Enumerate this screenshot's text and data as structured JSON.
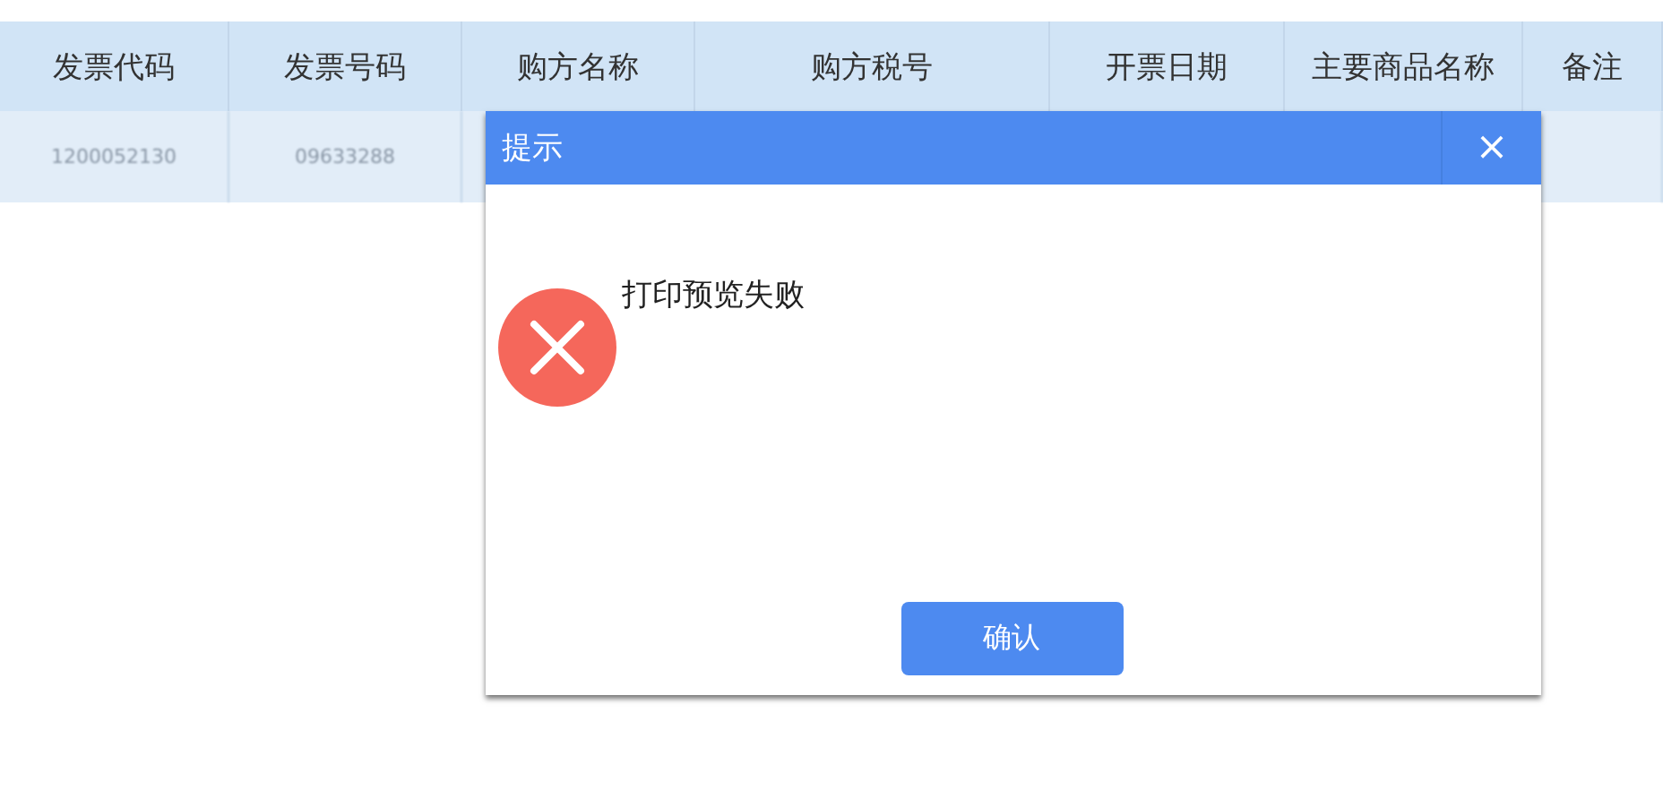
{
  "table": {
    "columns": [
      "发票代码",
      "发票号码",
      "购方名称",
      "购方税号",
      "开票日期",
      "主要商品名称",
      "备注"
    ],
    "rows": [
      [
        "1200052130",
        "09633288"
      ]
    ]
  },
  "dialog": {
    "title": "提示",
    "close": "×",
    "kind": "error",
    "message": "打印预览失败",
    "button": "确认"
  }
}
